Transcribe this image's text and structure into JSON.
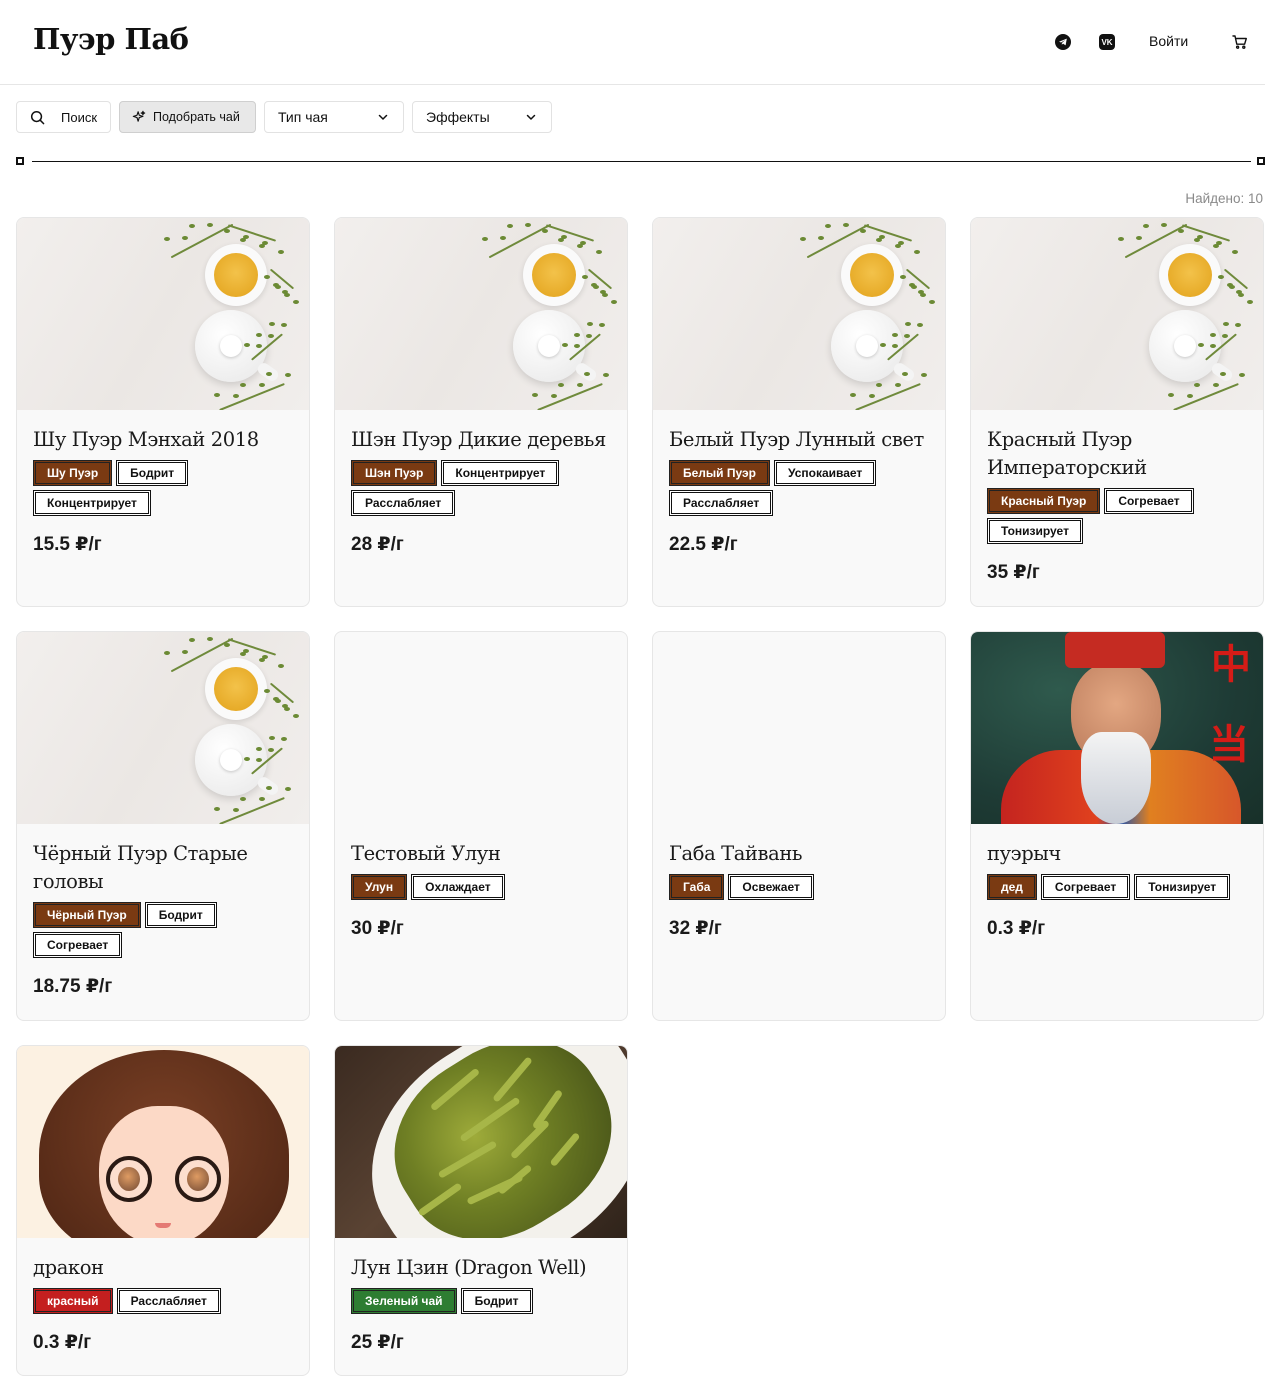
{
  "header": {
    "logo": "Пуэр Паб",
    "telegram_icon": "telegram-icon",
    "vk_icon": "vk-icon",
    "vk_label": "VK",
    "login": "Войти",
    "cart_icon": "cart-icon"
  },
  "filters": {
    "search_label": "Поиск",
    "pick_label": "Подобрать чай",
    "tea_type_label": "Тип чая",
    "effects_label": "Эффекты"
  },
  "results": {
    "found_label": "Найдено: 10"
  },
  "products": [
    {
      "title": "Шу Пуэр Мэнхай 2018",
      "category": "Шу Пуэр",
      "category_color": "#7a3a12",
      "effects": [
        "Бодрит",
        "Концентрирует"
      ],
      "price": "15.5 ₽/г",
      "image": "tea-set"
    },
    {
      "title": "Шэн Пуэр Дикие деревья",
      "category": "Шэн Пуэр",
      "category_color": "#7a3a12",
      "effects": [
        "Концентрирует",
        "Расслабляет"
      ],
      "price": "28 ₽/г",
      "image": "tea-set"
    },
    {
      "title": "Белый Пуэр Лунный свет",
      "category": "Белый Пуэр",
      "category_color": "#7a3a12",
      "effects": [
        "Успокаивает",
        "Расслабляет"
      ],
      "price": "22.5 ₽/г",
      "image": "tea-set"
    },
    {
      "title": "Красный Пуэр Императорский",
      "category": "Красный Пуэр",
      "category_color": "#7a3a12",
      "effects": [
        "Согревает",
        "Тонизирует"
      ],
      "price": "35 ₽/г",
      "image": "tea-set"
    },
    {
      "title": "Чёрный Пуэр Старые головы",
      "category": "Чёрный Пуэр",
      "category_color": "#7a3a12",
      "effects": [
        "Бодрит",
        "Согревает"
      ],
      "price": "18.75 ₽/г",
      "image": "tea-set"
    },
    {
      "title": "Тестовый Улун",
      "category": "Улун",
      "category_color": "#7a3a12",
      "effects": [
        "Охлаждает"
      ],
      "price": "30 ₽/г",
      "image": "none"
    },
    {
      "title": "Габа Тайвань",
      "category": "Габа",
      "category_color": "#7a3a12",
      "effects": [
        "Освежает"
      ],
      "price": "32 ₽/г",
      "image": "none"
    },
    {
      "title": "пуэрыч",
      "category": "дед",
      "category_color": "#7a3a12",
      "effects": [
        "Согревает",
        "Тонизирует"
      ],
      "price": "0.3 ₽/г",
      "image": "old-man"
    },
    {
      "title": "дракон",
      "category": "красный",
      "category_color": "#c41f1f",
      "effects": [
        "Расслабляет"
      ],
      "price": "0.3 ₽/г",
      "image": "girl"
    },
    {
      "title": "Лун Цзин (Dragon Well)",
      "category": "Зеленый чай",
      "category_color": "#2e7d32",
      "effects": [
        "Бодрит"
      ],
      "price": "25 ₽/г",
      "image": "green-leaves"
    }
  ]
}
